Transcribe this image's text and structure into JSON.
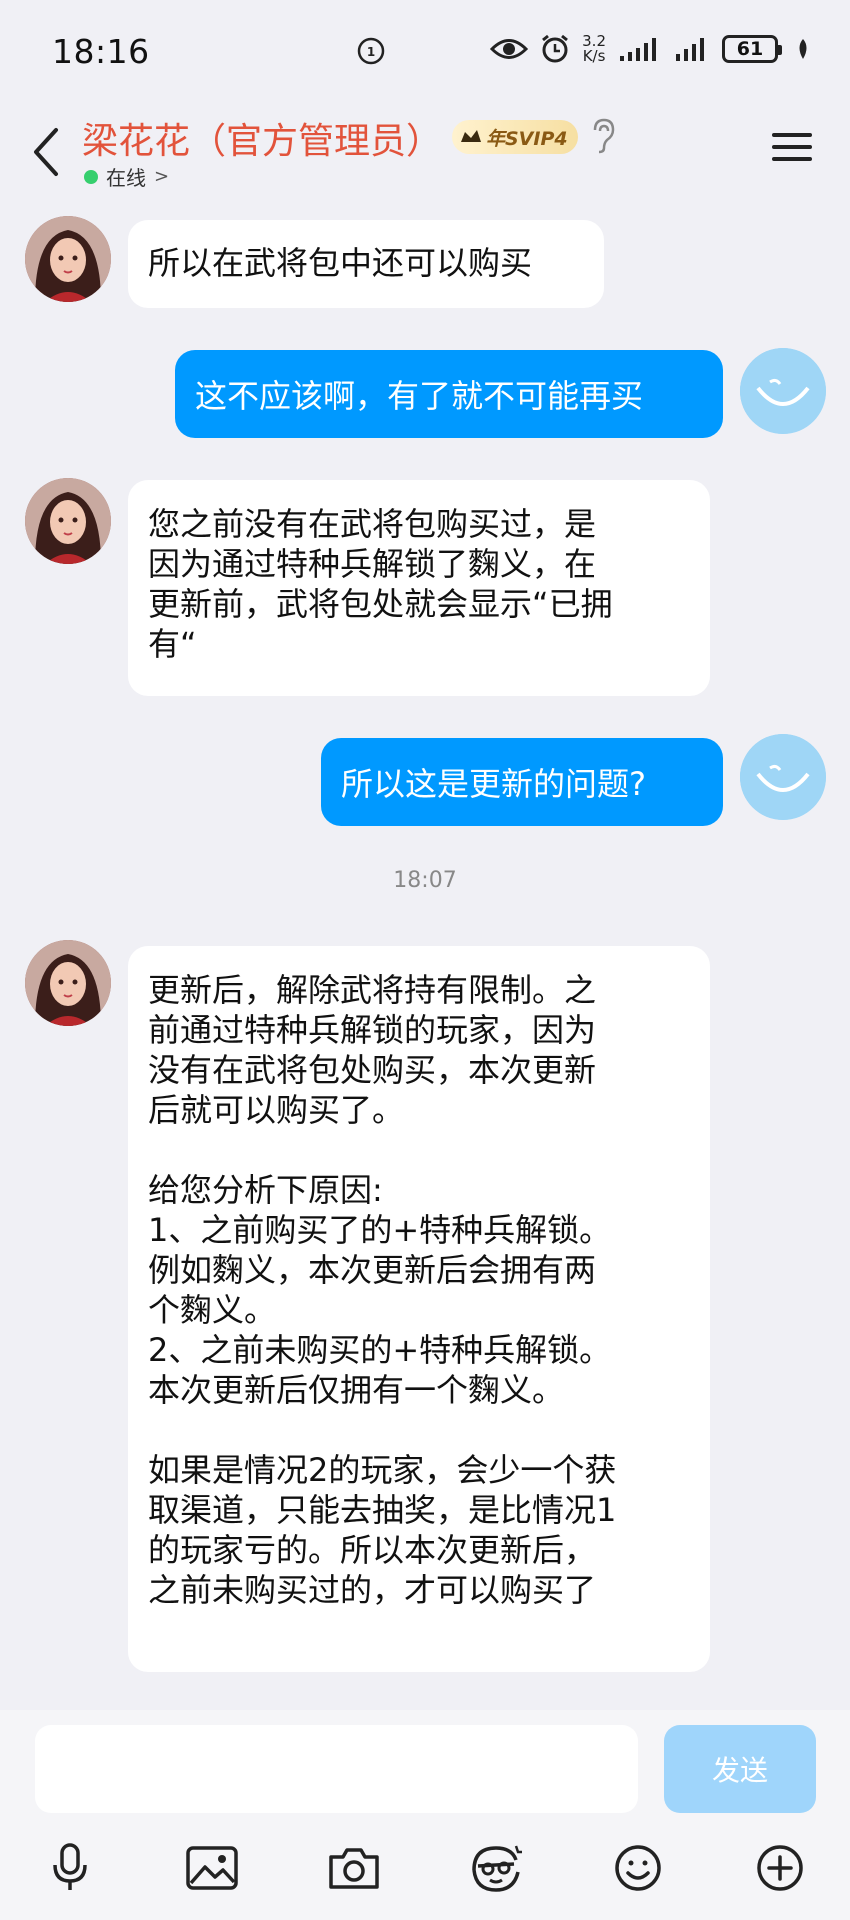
{
  "status_bar": {
    "time": "18:16",
    "net_speed_value": "3.2",
    "net_speed_unit": "K/s",
    "battery": "61"
  },
  "header": {
    "contact_name": "梁花花（官方管理员）",
    "badge": "年SVIP4",
    "status": "在线",
    "status_chevron": ">"
  },
  "messages": [
    {
      "side": "in",
      "text": "所以在武将包中还可以购买"
    },
    {
      "side": "out",
      "text": "这不应该啊，有了就不可能再买"
    },
    {
      "side": "in",
      "text": "您之前没有在武将包购买过，是\n因为通过特种兵解锁了麴义，在\n更新前，武将包处就会显示“已拥\n有“"
    },
    {
      "side": "out",
      "text": "所以这是更新的问题?"
    },
    {
      "side": "in",
      "text": "更新后，解除武将持有限制。之\n前通过特种兵解锁的玩家，因为\n没有在武将包处购买，本次更新\n后就可以购买了。\n\n给您分析下原因:\n1、之前购买了的+特种兵解锁。\n例如麴义，本次更新后会拥有两\n个麴义。\n2、之前未购买的+特种兵解锁。\n本次更新后仅拥有一个麴义。\n\n如果是情况2的玩家，会少一个获\n取渠道，只能去抽奖，是比情况1\n的玩家亏的。所以本次更新后，\n之前未购买过的，才可以购买了"
    }
  ],
  "time_divider": "18:07",
  "composer": {
    "input_value": "",
    "send_label": "发送"
  },
  "toolbar_icons": [
    "microphone-icon",
    "image-icon",
    "camera-icon",
    "sticker-face-icon",
    "emoji-icon",
    "plus-icon"
  ],
  "colors": {
    "contact_name": "#e2533b",
    "bubble_out": "#0099ff",
    "bubble_in": "#ffffff",
    "send_disabled": "#9fd5fb",
    "online": "#36cf6e",
    "background": "#f0f0f5"
  }
}
